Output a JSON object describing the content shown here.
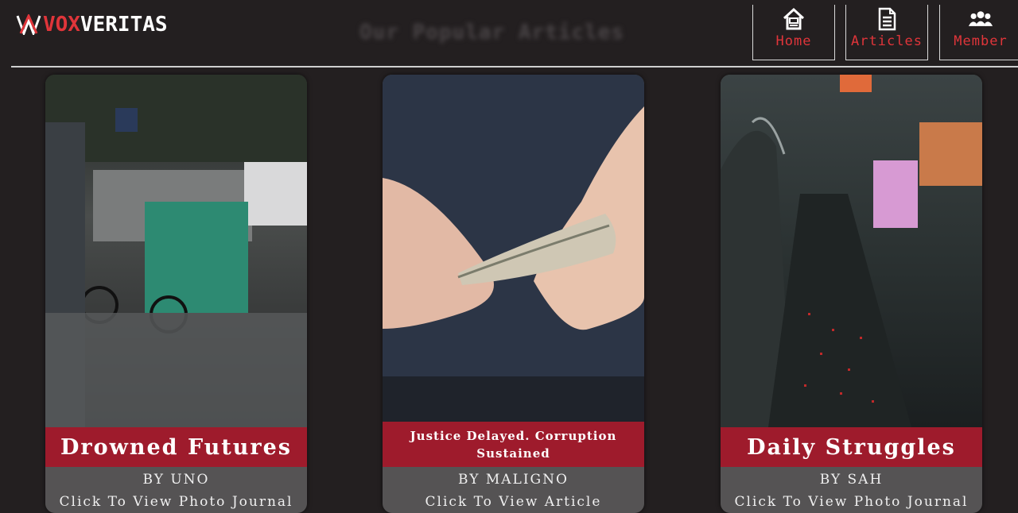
{
  "brand": {
    "part1": "VOX",
    "part2": "VERITAS"
  },
  "page_heading": "Our Popular Articles",
  "nav": [
    {
      "label": "Home",
      "icon": "home-icon"
    },
    {
      "label": "Articles",
      "icon": "document-icon"
    },
    {
      "label": "Member",
      "icon": "users-icon"
    }
  ],
  "cards": [
    {
      "title": "Drowned Futures",
      "byline": "BY UNO",
      "cta": "Click To View Photo Journal",
      "image": "flooded-street-pedicab-photo"
    },
    {
      "title": "Justice Delayed. Corruption Sustained",
      "byline": "BY MALIGNO",
      "cta": "Click To View Article",
      "image": "hands-holding-cash-photo"
    },
    {
      "title": "Daily Struggles",
      "byline": "BY SAH",
      "cta": "Click To View Photo Journal",
      "image": "traffic-jam-flyover-photo"
    }
  ],
  "colors": {
    "accent": "#e0353a",
    "title_bar": "#9e1b2c",
    "background": "#231f20"
  }
}
